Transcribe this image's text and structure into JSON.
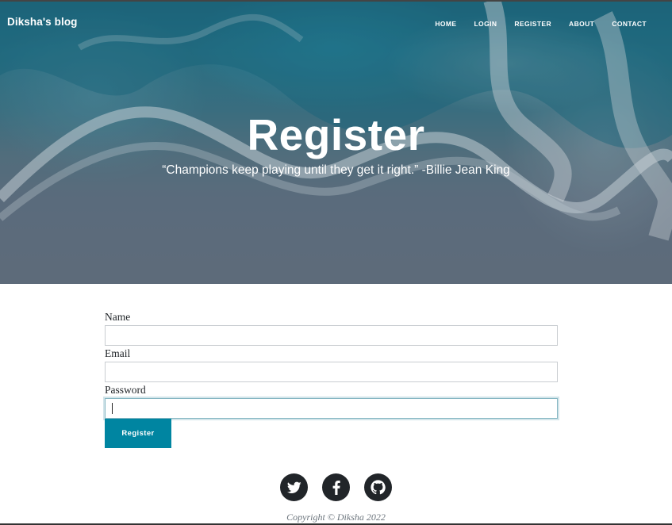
{
  "brand": "Diksha's blog",
  "nav": {
    "items": [
      "HOME",
      "LOGIN",
      "REGISTER",
      "ABOUT",
      "CONTACT"
    ]
  },
  "hero": {
    "title": "Register",
    "quote": "“Champions keep playing until they get it right.” -Billie Jean King"
  },
  "form": {
    "name_label": "Name",
    "name_value": "",
    "email_label": "Email",
    "email_value": "",
    "password_label": "Password",
    "password_value": "",
    "submit_label": "Register"
  },
  "footer": {
    "social_icons": [
      "twitter-icon",
      "facebook-icon",
      "github-icon"
    ],
    "copyright": "Copyright © Diksha 2022"
  },
  "colors": {
    "accent": "#0085a1",
    "social_bg": "#212529",
    "text": "#212529",
    "muted": "#6c757d"
  }
}
